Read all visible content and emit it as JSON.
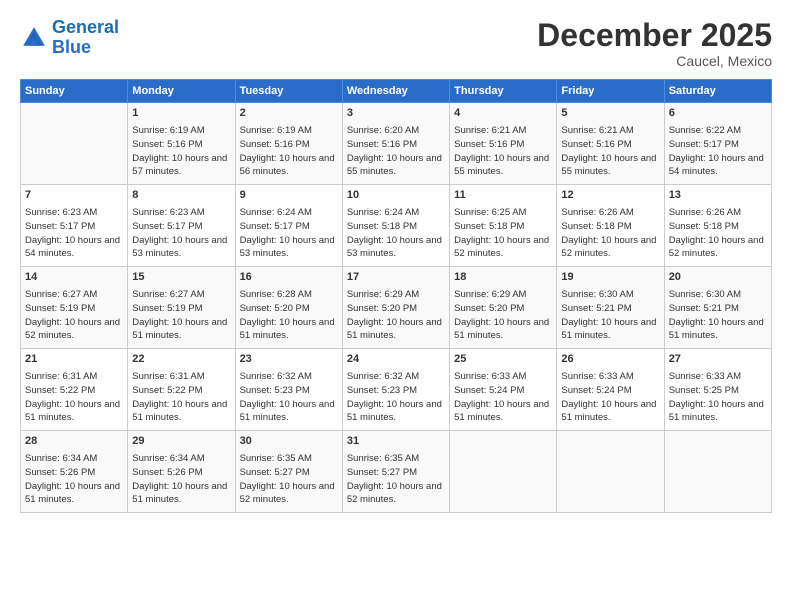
{
  "header": {
    "logo_general": "General",
    "logo_blue": "Blue",
    "month_title": "December 2025",
    "location": "Caucel, Mexico"
  },
  "weekdays": [
    "Sunday",
    "Monday",
    "Tuesday",
    "Wednesday",
    "Thursday",
    "Friday",
    "Saturday"
  ],
  "weeks": [
    [
      {
        "day": "",
        "sunrise": "",
        "sunset": "",
        "daylight": ""
      },
      {
        "day": "1",
        "sunrise": "Sunrise: 6:19 AM",
        "sunset": "Sunset: 5:16 PM",
        "daylight": "Daylight: 10 hours and 57 minutes."
      },
      {
        "day": "2",
        "sunrise": "Sunrise: 6:19 AM",
        "sunset": "Sunset: 5:16 PM",
        "daylight": "Daylight: 10 hours and 56 minutes."
      },
      {
        "day": "3",
        "sunrise": "Sunrise: 6:20 AM",
        "sunset": "Sunset: 5:16 PM",
        "daylight": "Daylight: 10 hours and 55 minutes."
      },
      {
        "day": "4",
        "sunrise": "Sunrise: 6:21 AM",
        "sunset": "Sunset: 5:16 PM",
        "daylight": "Daylight: 10 hours and 55 minutes."
      },
      {
        "day": "5",
        "sunrise": "Sunrise: 6:21 AM",
        "sunset": "Sunset: 5:16 PM",
        "daylight": "Daylight: 10 hours and 55 minutes."
      },
      {
        "day": "6",
        "sunrise": "Sunrise: 6:22 AM",
        "sunset": "Sunset: 5:17 PM",
        "daylight": "Daylight: 10 hours and 54 minutes."
      }
    ],
    [
      {
        "day": "7",
        "sunrise": "Sunrise: 6:23 AM",
        "sunset": "Sunset: 5:17 PM",
        "daylight": "Daylight: 10 hours and 54 minutes."
      },
      {
        "day": "8",
        "sunrise": "Sunrise: 6:23 AM",
        "sunset": "Sunset: 5:17 PM",
        "daylight": "Daylight: 10 hours and 53 minutes."
      },
      {
        "day": "9",
        "sunrise": "Sunrise: 6:24 AM",
        "sunset": "Sunset: 5:17 PM",
        "daylight": "Daylight: 10 hours and 53 minutes."
      },
      {
        "day": "10",
        "sunrise": "Sunrise: 6:24 AM",
        "sunset": "Sunset: 5:18 PM",
        "daylight": "Daylight: 10 hours and 53 minutes."
      },
      {
        "day": "11",
        "sunrise": "Sunrise: 6:25 AM",
        "sunset": "Sunset: 5:18 PM",
        "daylight": "Daylight: 10 hours and 52 minutes."
      },
      {
        "day": "12",
        "sunrise": "Sunrise: 6:26 AM",
        "sunset": "Sunset: 5:18 PM",
        "daylight": "Daylight: 10 hours and 52 minutes."
      },
      {
        "day": "13",
        "sunrise": "Sunrise: 6:26 AM",
        "sunset": "Sunset: 5:18 PM",
        "daylight": "Daylight: 10 hours and 52 minutes."
      }
    ],
    [
      {
        "day": "14",
        "sunrise": "Sunrise: 6:27 AM",
        "sunset": "Sunset: 5:19 PM",
        "daylight": "Daylight: 10 hours and 52 minutes."
      },
      {
        "day": "15",
        "sunrise": "Sunrise: 6:27 AM",
        "sunset": "Sunset: 5:19 PM",
        "daylight": "Daylight: 10 hours and 51 minutes."
      },
      {
        "day": "16",
        "sunrise": "Sunrise: 6:28 AM",
        "sunset": "Sunset: 5:20 PM",
        "daylight": "Daylight: 10 hours and 51 minutes."
      },
      {
        "day": "17",
        "sunrise": "Sunrise: 6:29 AM",
        "sunset": "Sunset: 5:20 PM",
        "daylight": "Daylight: 10 hours and 51 minutes."
      },
      {
        "day": "18",
        "sunrise": "Sunrise: 6:29 AM",
        "sunset": "Sunset: 5:20 PM",
        "daylight": "Daylight: 10 hours and 51 minutes."
      },
      {
        "day": "19",
        "sunrise": "Sunrise: 6:30 AM",
        "sunset": "Sunset: 5:21 PM",
        "daylight": "Daylight: 10 hours and 51 minutes."
      },
      {
        "day": "20",
        "sunrise": "Sunrise: 6:30 AM",
        "sunset": "Sunset: 5:21 PM",
        "daylight": "Daylight: 10 hours and 51 minutes."
      }
    ],
    [
      {
        "day": "21",
        "sunrise": "Sunrise: 6:31 AM",
        "sunset": "Sunset: 5:22 PM",
        "daylight": "Daylight: 10 hours and 51 minutes."
      },
      {
        "day": "22",
        "sunrise": "Sunrise: 6:31 AM",
        "sunset": "Sunset: 5:22 PM",
        "daylight": "Daylight: 10 hours and 51 minutes."
      },
      {
        "day": "23",
        "sunrise": "Sunrise: 6:32 AM",
        "sunset": "Sunset: 5:23 PM",
        "daylight": "Daylight: 10 hours and 51 minutes."
      },
      {
        "day": "24",
        "sunrise": "Sunrise: 6:32 AM",
        "sunset": "Sunset: 5:23 PM",
        "daylight": "Daylight: 10 hours and 51 minutes."
      },
      {
        "day": "25",
        "sunrise": "Sunrise: 6:33 AM",
        "sunset": "Sunset: 5:24 PM",
        "daylight": "Daylight: 10 hours and 51 minutes."
      },
      {
        "day": "26",
        "sunrise": "Sunrise: 6:33 AM",
        "sunset": "Sunset: 5:24 PM",
        "daylight": "Daylight: 10 hours and 51 minutes."
      },
      {
        "day": "27",
        "sunrise": "Sunrise: 6:33 AM",
        "sunset": "Sunset: 5:25 PM",
        "daylight": "Daylight: 10 hours and 51 minutes."
      }
    ],
    [
      {
        "day": "28",
        "sunrise": "Sunrise: 6:34 AM",
        "sunset": "Sunset: 5:26 PM",
        "daylight": "Daylight: 10 hours and 51 minutes."
      },
      {
        "day": "29",
        "sunrise": "Sunrise: 6:34 AM",
        "sunset": "Sunset: 5:26 PM",
        "daylight": "Daylight: 10 hours and 51 minutes."
      },
      {
        "day": "30",
        "sunrise": "Sunrise: 6:35 AM",
        "sunset": "Sunset: 5:27 PM",
        "daylight": "Daylight: 10 hours and 52 minutes."
      },
      {
        "day": "31",
        "sunrise": "Sunrise: 6:35 AM",
        "sunset": "Sunset: 5:27 PM",
        "daylight": "Daylight: 10 hours and 52 minutes."
      },
      {
        "day": "",
        "sunrise": "",
        "sunset": "",
        "daylight": ""
      },
      {
        "day": "",
        "sunrise": "",
        "sunset": "",
        "daylight": ""
      },
      {
        "day": "",
        "sunrise": "",
        "sunset": "",
        "daylight": ""
      }
    ]
  ]
}
